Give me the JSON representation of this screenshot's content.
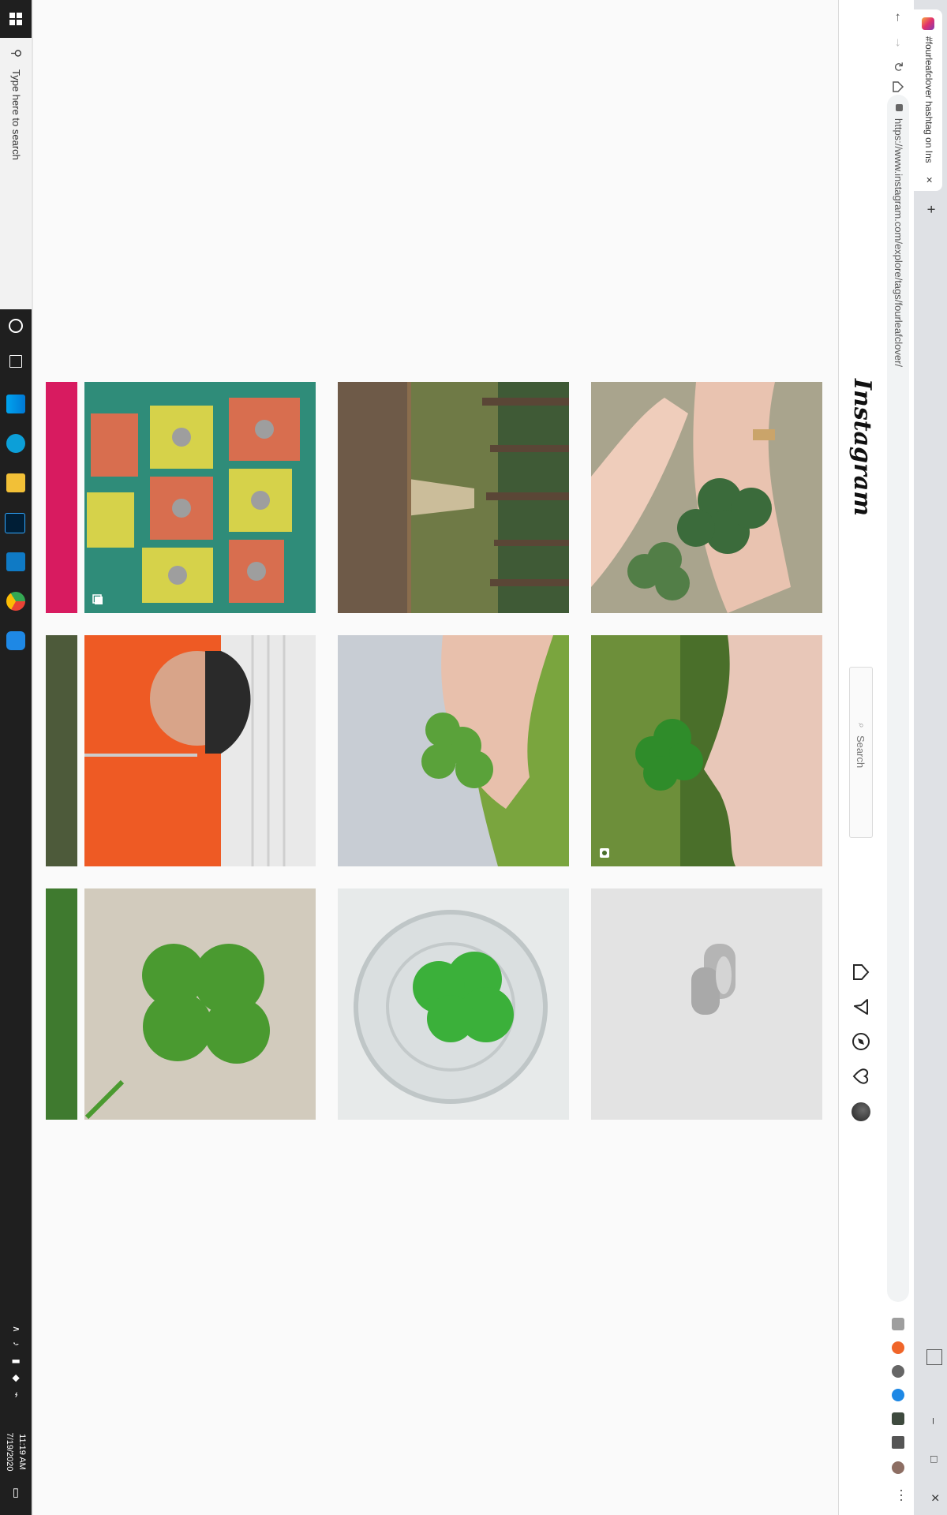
{
  "browser": {
    "tab_title": "#fourleafclover hashtag on Insta",
    "tab_close": "×",
    "new_tab": "+",
    "url": "https://www.instagram.com/explore/tags/fourleafclover/",
    "min": "–",
    "max": "□",
    "close": "×"
  },
  "instagram": {
    "logo": "Instagram",
    "search_placeholder": "Search"
  },
  "grid": {
    "tiles": [
      {
        "name": "post-pink-partial"
      },
      {
        "name": "post-clover-ring-hands"
      },
      {
        "name": "post-garden-path"
      },
      {
        "name": "post-butterfly-earrings"
      },
      {
        "name": "post-framed-partial"
      },
      {
        "name": "post-clover-held-grass"
      },
      {
        "name": "post-clover-held-fingers"
      },
      {
        "name": "post-smiling-child"
      },
      {
        "name": "post-green-partial"
      },
      {
        "name": "post-silver-rings"
      },
      {
        "name": "post-clover-in-glass"
      },
      {
        "name": "post-four-leaf-closeup"
      }
    ]
  },
  "taskbar": {
    "search_placeholder": "Type here to search",
    "time": "11:19 AM",
    "date": "7/19/2020"
  }
}
